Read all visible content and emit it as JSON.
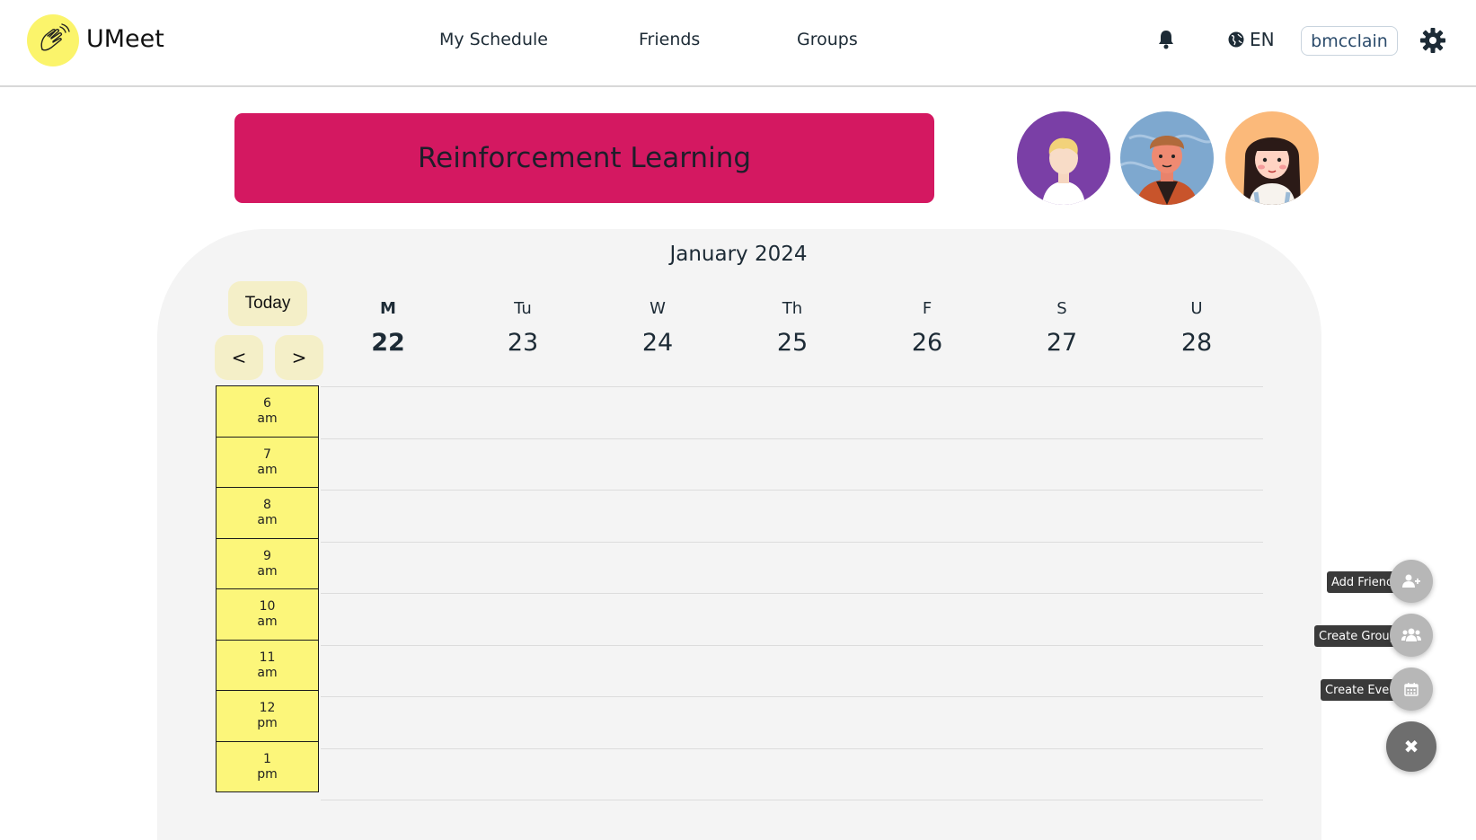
{
  "header": {
    "brand": "UMeet",
    "nav": [
      "My Schedule",
      "Friends",
      "Groups"
    ],
    "language": "EN",
    "username": "bmcclain"
  },
  "group": {
    "name": "Reinforcement Learning"
  },
  "calendar": {
    "month_label": "January 2024",
    "today_label": "Today",
    "prev_label": "<",
    "next_label": ">",
    "days": [
      {
        "letter": "M",
        "num": "22",
        "active": true
      },
      {
        "letter": "Tu",
        "num": "23"
      },
      {
        "letter": "W",
        "num": "24"
      },
      {
        "letter": "Th",
        "num": "25"
      },
      {
        "letter": "F",
        "num": "26"
      },
      {
        "letter": "S",
        "num": "27"
      },
      {
        "letter": "U",
        "num": "28"
      }
    ],
    "slots": [
      {
        "hour": "6",
        "period": "am"
      },
      {
        "hour": "7",
        "period": "am"
      },
      {
        "hour": "8",
        "period": "am"
      },
      {
        "hour": "9",
        "period": "am"
      },
      {
        "hour": "10",
        "period": "am"
      },
      {
        "hour": "11",
        "period": "am"
      },
      {
        "hour": "12",
        "period": "pm"
      },
      {
        "hour": "1",
        "period": "pm"
      }
    ]
  },
  "fab": {
    "add_friend": "Add Friend",
    "create_group": "Create Group",
    "create_event": "Create Event",
    "close_symbol": "✖"
  },
  "colors": {
    "banner": "#d41861",
    "slot": "#fcf67a",
    "logo": "#fbf46b",
    "button_bg": "#f4efc8"
  }
}
